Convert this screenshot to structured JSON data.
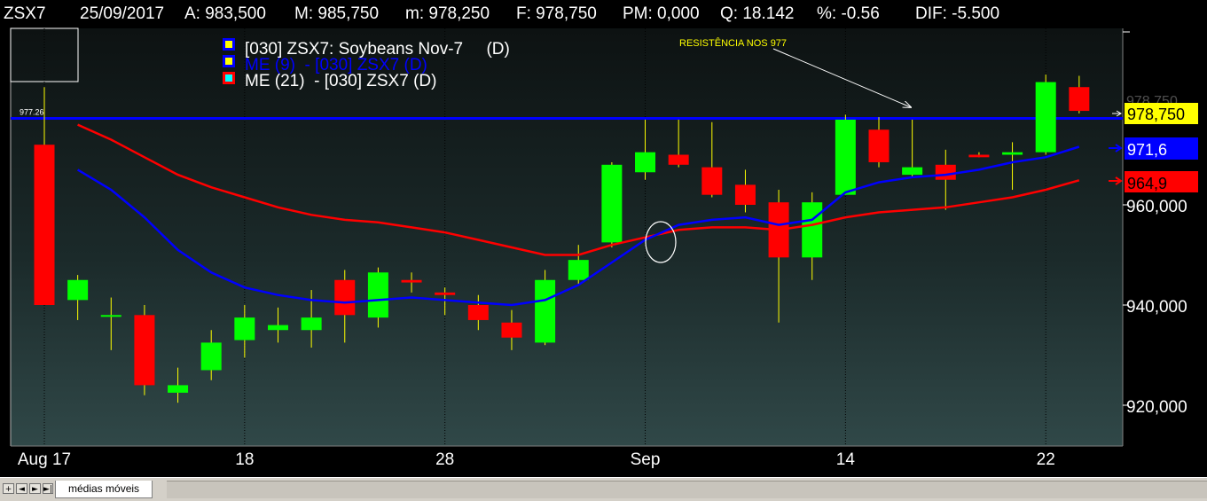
{
  "header": {
    "symbol": "ZSX7",
    "date": "25/09/2017",
    "open": "A: 983,500",
    "high": "M: 985,750",
    "low": "m: 978,250",
    "close": "F: 978,750",
    "pm": "PM: 0,000",
    "qty": "Q: 18.142",
    "pct": "%: -0.56",
    "dif": "DIF: -5.500"
  },
  "legend": [
    {
      "label": "[030] ZSX7: Soybeans Nov-7     (D)",
      "box_color": "#0000ff",
      "inner_color": "#ffff00"
    },
    {
      "label": "ME (9)  - [030] ZSX7 (D)",
      "box_color": "#0000ff",
      "inner_color": "#ffff00"
    },
    {
      "label": "ME (21)  - [030] ZSX7 (D)",
      "box_color": "#ff0000",
      "inner_color": "#00ffff"
    }
  ],
  "annotation": "RESISTÊNCIA NOS 977",
  "price_tags": {
    "last": "978,750",
    "ema9": "971,6",
    "ema21": "964,9"
  },
  "resistance": {
    "value": 977.26,
    "label": "977.26"
  },
  "tab": {
    "label": "médias móveis"
  },
  "nav": {
    "first": "+",
    "prev": "◄",
    "next": "►",
    "last": "►|"
  },
  "colors": {
    "up_candle": "#00ff00",
    "down_candle": "#ff0000",
    "ema9": "#0000ff",
    "ema21": "#ff0000",
    "resistance": "#0000ff",
    "last_tag": "#ffff00",
    "wick": "#ffff00"
  },
  "chart_data": {
    "type": "candlestick",
    "x_ticks": [
      "Aug 17",
      "18",
      "28",
      "Sep",
      "14",
      "22"
    ],
    "y_ticks": [
      "920,000",
      "940,000",
      "960,000"
    ],
    "ylim": [
      910,
      985
    ],
    "candles": [
      {
        "o": 972.0,
        "h": 983.5,
        "l": 940.0,
        "c": 940.0
      },
      {
        "o": 941.0,
        "h": 946.0,
        "l": 937.0,
        "c": 945.0
      },
      {
        "o": 938.0,
        "h": 941.5,
        "l": 931.0,
        "c": 938.0
      },
      {
        "o": 938.0,
        "h": 940.0,
        "l": 922.0,
        "c": 924.0
      },
      {
        "o": 922.5,
        "h": 927.5,
        "l": 920.5,
        "c": 924.0
      },
      {
        "o": 927.0,
        "h": 935.0,
        "l": 925.0,
        "c": 932.5
      },
      {
        "o": 933.0,
        "h": 940.0,
        "l": 929.5,
        "c": 937.5
      },
      {
        "o": 935.0,
        "h": 939.5,
        "l": 932.5,
        "c": 936.0
      },
      {
        "o": 935.0,
        "h": 943.0,
        "l": 931.5,
        "c": 937.5
      },
      {
        "o": 945.0,
        "h": 947.0,
        "l": 932.5,
        "c": 938.0
      },
      {
        "o": 937.5,
        "h": 947.5,
        "l": 935.5,
        "c": 946.5
      },
      {
        "o": 945.0,
        "h": 946.5,
        "l": 942.5,
        "c": 944.5
      },
      {
        "o": 942.5,
        "h": 943.5,
        "l": 938.0,
        "c": 942.0
      },
      {
        "o": 940.0,
        "h": 942.0,
        "l": 935.0,
        "c": 937.0
      },
      {
        "o": 936.5,
        "h": 939.0,
        "l": 931.0,
        "c": 933.5
      },
      {
        "o": 932.5,
        "h": 947.0,
        "l": 932.0,
        "c": 945.0
      },
      {
        "o": 945.0,
        "h": 952.0,
        "l": 944.0,
        "c": 949.0
      },
      {
        "o": 952.5,
        "h": 968.5,
        "l": 951.5,
        "c": 968.0
      },
      {
        "o": 966.5,
        "h": 977.0,
        "l": 965.0,
        "c": 970.5
      },
      {
        "o": 970.0,
        "h": 977.0,
        "l": 967.5,
        "c": 968.0
      },
      {
        "o": 967.5,
        "h": 976.5,
        "l": 961.5,
        "c": 962.0
      },
      {
        "o": 964.0,
        "h": 967.0,
        "l": 958.5,
        "c": 960.0
      },
      {
        "o": 960.5,
        "h": 963.0,
        "l": 936.5,
        "c": 949.5
      },
      {
        "o": 949.5,
        "h": 962.5,
        "l": 945.0,
        "c": 960.5
      },
      {
        "o": 962.0,
        "h": 978.0,
        "l": 962.0,
        "c": 977.0
      },
      {
        "o": 975.0,
        "h": 977.5,
        "l": 967.5,
        "c": 968.5
      },
      {
        "o": 966.0,
        "h": 977.0,
        "l": 965.5,
        "c": 967.5
      },
      {
        "o": 968.0,
        "h": 971.0,
        "l": 959.0,
        "c": 965.0
      },
      {
        "o": 970.0,
        "h": 970.5,
        "l": 969.5,
        "c": 969.5
      },
      {
        "o": 970.0,
        "h": 972.5,
        "l": 963.0,
        "c": 970.5
      },
      {
        "o": 970.5,
        "h": 986.0,
        "l": 970.0,
        "c": 984.5
      },
      {
        "o": 983.5,
        "h": 985.75,
        "l": 978.25,
        "c": 978.75
      }
    ],
    "ema9": [
      null,
      967.0,
      963.0,
      957.5,
      951.0,
      946.5,
      943.5,
      942.0,
      941.0,
      940.5,
      941.0,
      941.5,
      941.0,
      940.5,
      940.0,
      941.0,
      944.0,
      948.5,
      953.0,
      956.0,
      957.0,
      957.5,
      956.0,
      957.0,
      962.5,
      964.5,
      965.5,
      966.0,
      967.0,
      968.5,
      969.5,
      971.6
    ],
    "ema21": [
      null,
      976.0,
      973.0,
      969.5,
      966.0,
      963.5,
      961.5,
      959.5,
      958.0,
      957.0,
      956.5,
      955.5,
      954.5,
      953.0,
      951.5,
      950.0,
      950.0,
      952.0,
      953.5,
      955.0,
      955.5,
      955.5,
      955.0,
      956.0,
      957.5,
      958.5,
      959.0,
      959.5,
      960.5,
      961.5,
      963.0,
      964.9
    ]
  }
}
